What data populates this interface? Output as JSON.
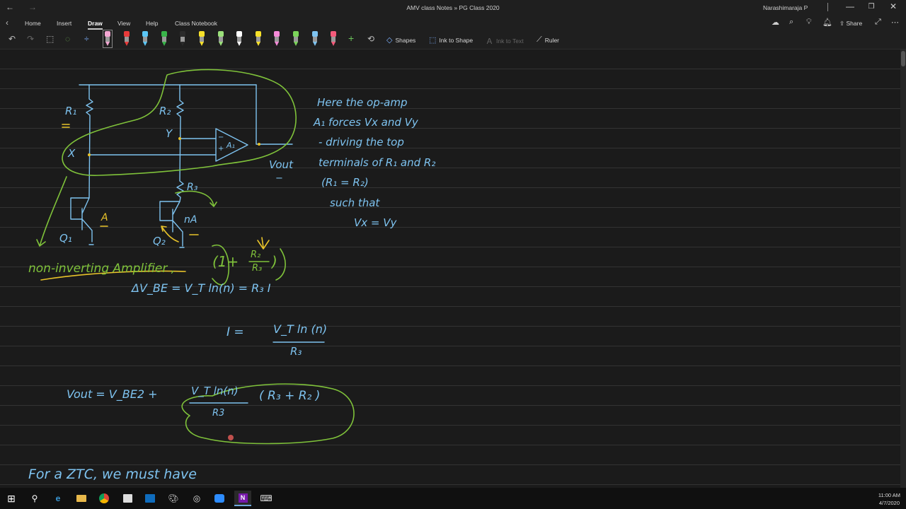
{
  "window": {
    "title": "AMV class Notes » PG Class 2020",
    "user": "Narashimaraja P",
    "back_icon": "←",
    "forward_icon": "→",
    "minimize_icon": "—",
    "restore_icon": "❐",
    "close_icon": "✕"
  },
  "menu": {
    "back_icon": "‹",
    "tabs": [
      "Home",
      "Insert",
      "Draw",
      "View",
      "Help",
      "Class Notebook"
    ],
    "active_tab": "Draw",
    "share_label": "Share",
    "more_icon": "⋯"
  },
  "ribbon": {
    "undo_icon": "↶",
    "redo_icon": "↷",
    "lasso_icon": "⬚",
    "eraser_icon": "⌫",
    "space_icon": "÷",
    "add_pen_icon": "+",
    "pens": [
      {
        "color": "#f4a7d3"
      },
      {
        "color": "#e83a3a"
      },
      {
        "color": "#5bc6f5"
      },
      {
        "color": "#39b54a"
      },
      {
        "color": "#2b2b2b"
      },
      {
        "color": "#f7e12a"
      },
      {
        "color": "#9be07a"
      },
      {
        "color": "#ffffff"
      },
      {
        "color": "#f7e12a"
      },
      {
        "color": "#f58ad8"
      },
      {
        "color": "#7bd45a"
      },
      {
        "color": "#7ec3f0"
      },
      {
        "color": "#f25a7a"
      }
    ],
    "shapes_label": "Shapes",
    "ink_to_shape_label": "Ink to Shape",
    "ink_to_text_label": "Ink to Text",
    "ruler_label": "Ruler"
  },
  "notes": {
    "R1": "R₁",
    "R2": "R₂",
    "R3": "R₃",
    "X": "X",
    "Y": "Y",
    "A1": "A₁",
    "Q1": "Q₁",
    "Q2": "Q₂",
    "A": "A",
    "nA": "nA",
    "vout": "Vout",
    "plus": "+",
    "minus": "−",
    "minus2": "−",
    "plus2": "+",
    "side_text": [
      "Here the op-amp",
      "A₁ forces Vx and Vy",
      "- driving the top",
      "terminals of R₁ and R₂",
      "(R₁ = R₂)",
      "such that",
      "Vx = Vy"
    ],
    "non_inverting": "non-inverting Amplifier ,",
    "gain_open": "(1+",
    "gain_num": "R₂",
    "gain_den": "R₃",
    "gain_close": ")",
    "eq1": "ΔV_BE = V_T ln(n) = R₃ I",
    "eq2_left": "I =",
    "eq2_num": "V_T ln (n)",
    "eq2_den": "R₃",
    "eq3_left": "Vout = V_BE2 +",
    "eq3_num": "V_T ln(n)",
    "eq3_den": "R3",
    "eq3_right": "( R₃ + R₂ )",
    "bottom": "For a ZTC, we must have"
  },
  "taskbar": {
    "start_icon": "⊞",
    "search_icon": "⚲",
    "apps": [
      "edge",
      "file-explorer",
      "chrome",
      "store",
      "outlook",
      "paint",
      "media",
      "zoom",
      "onenote",
      "misc"
    ],
    "time": "11:00 AM",
    "date": "4/7/2020"
  }
}
